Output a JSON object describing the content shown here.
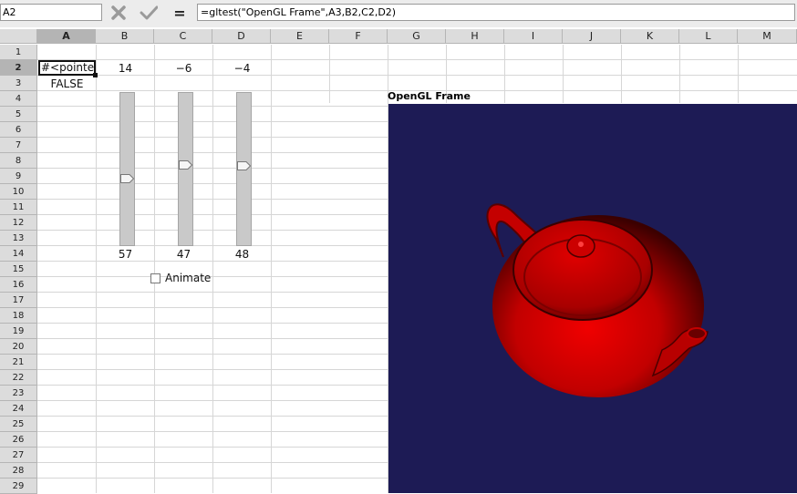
{
  "formula_bar": {
    "name_box": "A2",
    "cancel_icon": "cross-icon",
    "accept_icon": "checkmark-icon",
    "equals_label": "=",
    "formula": "=gltest(\"OpenGL Frame\",A3,B2,C2,D2)"
  },
  "columns": [
    "A",
    "B",
    "C",
    "D",
    "E",
    "F",
    "G",
    "H",
    "I",
    "J",
    "K",
    "L",
    "M"
  ],
  "selected_column": "A",
  "rows": [
    "1",
    "2",
    "3",
    "4",
    "5",
    "6",
    "7",
    "8",
    "9",
    "10",
    "11",
    "12",
    "13",
    "14",
    "15",
    "16",
    "17",
    "18",
    "19",
    "20",
    "21",
    "22",
    "23",
    "24",
    "25",
    "26",
    "27",
    "28",
    "29"
  ],
  "selected_row": "2",
  "cells": {
    "A2": "#<pointer !",
    "A3": "FALSE",
    "B2": "14",
    "C2": "−6",
    "D2": "−4",
    "B14": "57",
    "C14": "47",
    "D14": "48"
  },
  "sliders": [
    {
      "column": "B",
      "value": 57
    },
    {
      "column": "C",
      "value": 47
    },
    {
      "column": "D",
      "value": 48
    }
  ],
  "animate_checkbox": {
    "label": "Animate",
    "checked": false
  },
  "opengl": {
    "title": "OpenGL Frame",
    "background_color": "#1d1b55",
    "object": "teapot",
    "object_color": "#d40000"
  }
}
